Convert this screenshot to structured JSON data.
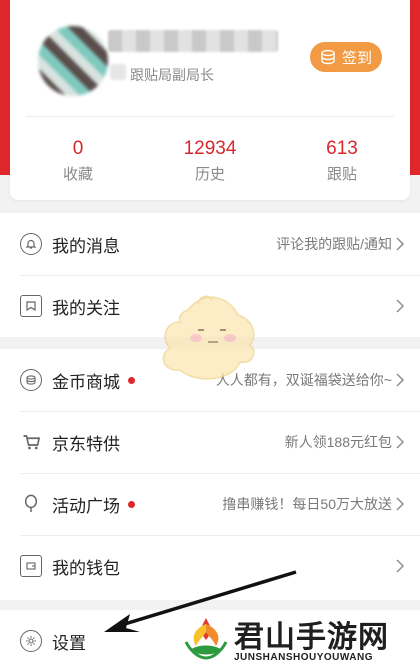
{
  "profile": {
    "user_title": "跟贴局副局长",
    "checkin_label": "签到"
  },
  "stats": [
    {
      "value": "0",
      "label": "收藏"
    },
    {
      "value": "12934",
      "label": "历史"
    },
    {
      "value": "613",
      "label": "跟贴"
    }
  ],
  "menu": {
    "messages": {
      "label": "我的消息",
      "extra": "评论我的跟贴/通知"
    },
    "following": {
      "label": "我的关注",
      "extra": ""
    },
    "coin_mall": {
      "label": "金币商城",
      "extra": "人人都有，双诞福袋送给你~"
    },
    "jd": {
      "label": "京东特供",
      "extra": "新人领188元红包"
    },
    "events": {
      "label": "活动广场",
      "extra": "撸串赚钱！每日50万大放送"
    },
    "wallet": {
      "label": "我的钱包",
      "extra": ""
    },
    "settings": {
      "label": "设置"
    }
  },
  "watermark": {
    "title": "君山手游网",
    "subtitle": "JUNSHANSHOUYOUWANG"
  },
  "colors": {
    "brand_red": "#e0272b",
    "checkin_orange": "#f39b44"
  }
}
